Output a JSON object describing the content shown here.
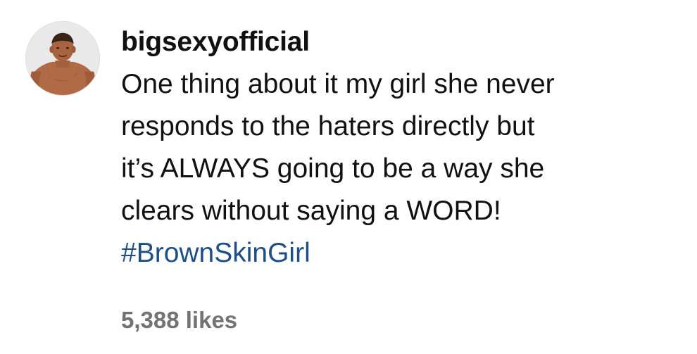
{
  "post": {
    "username": "bigsexyofficial",
    "caption_lines": [
      "One thing about it my girl she never",
      "responds to the haters directly but",
      "it’s ALWAYS going to be a way she",
      "clears without saying a WORD!"
    ],
    "hashtag": "#BrownSkinGirl",
    "likes": "5,388 likes"
  },
  "colors": {
    "text": "#111111",
    "hashtag": "#1d4f86",
    "muted": "#737373",
    "background": "#ffffff"
  },
  "icons": {
    "avatar": "profile-photo"
  }
}
